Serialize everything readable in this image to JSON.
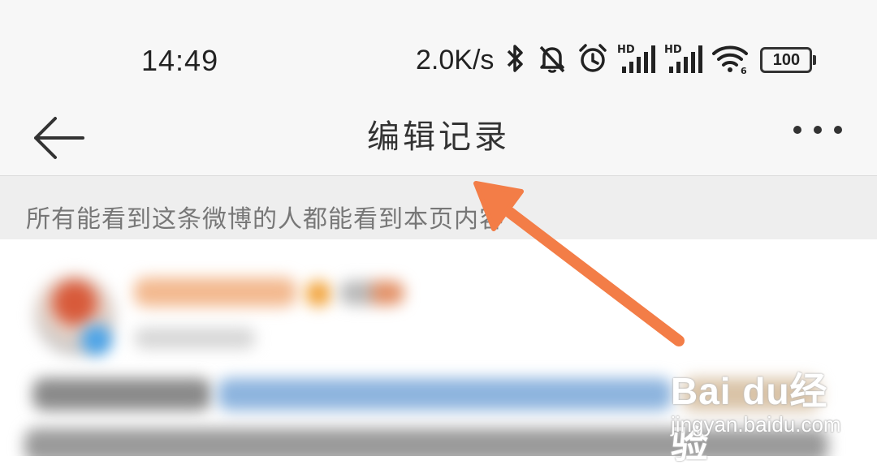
{
  "status_bar": {
    "time": "14:49",
    "net_speed": "2.0K/s",
    "hd_label_1": "HD",
    "hd_label_2": "HD",
    "wifi_sub": "6",
    "battery": "100",
    "icons": [
      "bluetooth-icon",
      "silent-bell-icon",
      "alarm-icon",
      "signal-hd-icon",
      "signal-hd-icon",
      "wifi-icon",
      "battery-icon"
    ]
  },
  "nav": {
    "title": "编辑记录",
    "back_icon": "back-arrow-icon",
    "more_icon": "more-dots-icon"
  },
  "notice": {
    "text": "所有能看到这条微博的人都能看到本页内容"
  },
  "annotation": {
    "color": "#f37d47"
  },
  "watermark": {
    "logo": "Bai du经验",
    "sub": "jingyan.baidu.com"
  }
}
